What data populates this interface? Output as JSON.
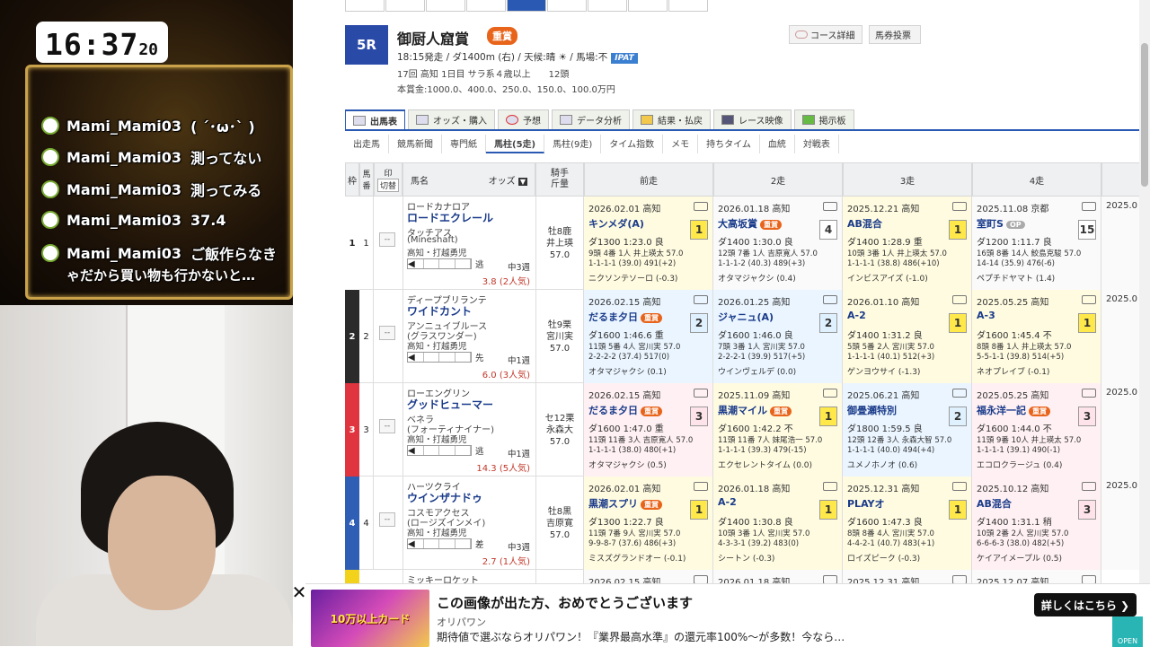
{
  "stream": {
    "clock_hm": "16:37",
    "clock_sec": "20",
    "chat": [
      {
        "user": "Mami_Mami03",
        "msg": "( ´･ω･` )"
      },
      {
        "user": "Mami_Mami03",
        "msg": "測ってない"
      },
      {
        "user": "Mami_Mami03",
        "msg": "測ってみる"
      },
      {
        "user": "Mami_Mami03",
        "msg": "37.4"
      },
      {
        "user": "Mami_Mami03",
        "msg": "ご飯作らなき"
      }
    ],
    "chat_cont": "ゃだから買い物も行かないと…"
  },
  "race": {
    "number": "5R",
    "name": "御厨人窟賞",
    "grade": "重賞",
    "info1": "18:15発走 / ダ1400m (右) / 天候:晴 ☀ / 馬場:不",
    "ipat": "IPAT",
    "info2": "17回 高知 1日目 サラ系４歳以上　　12頭",
    "info3": "本賞金:1000.0、400.0、250.0、150.0、100.0万円",
    "course_btn": "コース詳細",
    "vote_btn": "馬券投票"
  },
  "main_tabs": [
    "出馬表",
    "オッズ・購入",
    "予想",
    "データ分析",
    "結果・払戻",
    "レース映像",
    "掲示板"
  ],
  "sub_tabs": [
    "出走馬",
    "競馬新聞",
    "専門紙",
    "馬柱(5走)",
    "馬柱(9走)",
    "タイム指数",
    "メモ",
    "持ちタイム",
    "血統",
    "対戦表"
  ],
  "headers": {
    "waku": "枠",
    "uma": "馬番",
    "mark": "印",
    "mark_sw": "切替",
    "horse": "馬名",
    "odds": "オッズ",
    "jockey": "騎手\n斤量",
    "p1": "前走",
    "p2": "2走",
    "p3": "3走",
    "p4": "4走"
  },
  "rows": [
    {
      "waku": "1",
      "uma": "1",
      "waku_color": "#ffffff",
      "waku_text": "#222",
      "sire": "ロードカナロア",
      "name": "ロードエクレール",
      "dam": "タッチアス",
      "bms": "(Mineshaft)",
      "owner": "高知・打越勇児",
      "style": "逃",
      "interval": "中3週",
      "odds": "3.8 (2人気)",
      "jockey": [
        "牡8鹿",
        "井上瑛",
        "57.0"
      ],
      "past": [
        {
          "date": "2026.02.01 高知",
          "race": "キンメダ(A)",
          "grade": "",
          "place": "1",
          "l1": "ダ1300 1:23.0 良",
          "l2": "9頭 4番 1人 井上瑛太 57.0",
          "l3": "1-1-1-1 (39.0) 491(+2)",
          "l4": "ニクソンテソーロ (-0.3)",
          "bg": "bg1"
        },
        {
          "date": "2026.01.18 高知",
          "race": "大高坂賞",
          "grade": "重賞",
          "place": "4",
          "l1": "ダ1400 1:30.0 良",
          "l2": "12頭 7番 1人 吉原寛人 57.0",
          "l3": "1-1-1-2 (40.3) 489(+3)",
          "l4": "オタマジャクシ (0.4)",
          "bg": "bgn"
        },
        {
          "date": "2025.12.21 高知",
          "race": "AB混合",
          "grade": "",
          "place": "1",
          "l1": "ダ1400 1:28.9 重",
          "l2": "10頭 3番 1人 井上瑛太 57.0",
          "l3": "1-1-1-1 (38.8) 486(+10)",
          "l4": "インビスアイズ (-1.0)",
          "bg": "bg1"
        },
        {
          "date": "2025.11.08 京都",
          "race": "室町S",
          "grade": "OP",
          "place": "15",
          "l1": "ダ1200 1:11.7 良",
          "l2": "16頭 8番 14人 鮫島克駿 57.0",
          "l3": "14-14 (35.9) 476(-6)",
          "l4": "ペプチドヤマト (1.4)",
          "bg": "bgn"
        }
      ]
    },
    {
      "waku": "2",
      "uma": "2",
      "waku_color": "#2b2b2b",
      "waku_text": "#fff",
      "sire": "ディープブリランテ",
      "name": "ワイドカント",
      "dam": "アンニュイブルース",
      "bms": "(グラスワンダー)",
      "owner": "高知・打越勇児",
      "style": "先",
      "interval": "中1週",
      "odds": "6.0 (3人気)",
      "jockey": [
        "牡9栗",
        "宮川実",
        "57.0"
      ],
      "past": [
        {
          "date": "2026.02.15 高知",
          "race": "だるま夕日",
          "grade": "重賞",
          "place": "2",
          "l1": "ダ1600 1:46.6 重",
          "l2": "11頭 5番 4人 宮川実 57.0",
          "l3": "2-2-2-2 (37.4) 517(0)",
          "l4": "オタマジャクシ (0.1)",
          "bg": "bg2"
        },
        {
          "date": "2026.01.25 高知",
          "race": "ジャニュ(A)",
          "grade": "",
          "place": "2",
          "l1": "ダ1600 1:46.0 良",
          "l2": "7頭 3番 1人 宮川実 57.0",
          "l3": "2-2-2-1 (39.9) 517(+5)",
          "l4": "ウインヴェルデ (0.0)",
          "bg": "bg2"
        },
        {
          "date": "2026.01.10 高知",
          "race": "A-2",
          "grade": "",
          "place": "1",
          "l1": "ダ1400 1:31.2 良",
          "l2": "5頭 5番 2人 宮川実 57.0",
          "l3": "1-1-1-1 (40.1) 512(+3)",
          "l4": "ゲンヨウサイ (-1.3)",
          "bg": "bg1"
        },
        {
          "date": "2025.05.25 高知",
          "race": "A-3",
          "grade": "",
          "place": "1",
          "l1": "ダ1600 1:45.4 不",
          "l2": "8頭 8番 1人 井上瑛太 57.0",
          "l3": "5-5-1-1 (39.8) 514(+5)",
          "l4": "ネオプレイブ (-0.1)",
          "bg": "bg1"
        }
      ]
    },
    {
      "waku": "3",
      "uma": "3",
      "waku_color": "#e0343e",
      "waku_text": "#fff",
      "sire": "ローエングリン",
      "name": "グッドヒューマー",
      "dam": "ベネラ",
      "bms": "(フォーティナイナー)",
      "owner": "高知・打越勇児",
      "style": "逃",
      "interval": "中1週",
      "odds": "14.3 (5人気)",
      "jockey": [
        "セ12栗",
        "永森大",
        "57.0"
      ],
      "past": [
        {
          "date": "2026.02.15 高知",
          "race": "だるま夕日",
          "grade": "重賞",
          "place": "3",
          "l1": "ダ1600 1:47.0 重",
          "l2": "11頭 11番 3人 吉原寛人 57.0",
          "l3": "1-1-1-1 (38.0) 480(+1)",
          "l4": "オタマジャクシ (0.5)",
          "bg": "bg3"
        },
        {
          "date": "2025.11.09 高知",
          "race": "黒潮マイル",
          "grade": "重賞",
          "place": "1",
          "l1": "ダ1600 1:42.2 不",
          "l2": "11頭 11番 7人 妹尾浩一 57.0",
          "l3": "1-1-1-1 (39.3) 479(-15)",
          "l4": "エクセレントタイム (0.0)",
          "bg": "bg1"
        },
        {
          "date": "2025.06.21 高知",
          "race": "御畳瀬特別",
          "grade": "",
          "place": "2",
          "l1": "ダ1800 1:59.5 良",
          "l2": "12頭 12番 3人 永森大智 57.0",
          "l3": "1-1-1-1 (40.0) 494(+4)",
          "l4": "ユメノホノオ (0.6)",
          "bg": "bg2"
        },
        {
          "date": "2025.05.25 高知",
          "race": "福永洋一記",
          "grade": "重賞",
          "place": "3",
          "l1": "ダ1600 1:44.0 不",
          "l2": "11頭 9番 10人 井上瑛太 57.0",
          "l3": "1-1-1-1 (39.1) 490(-1)",
          "l4": "エコロクラージュ (0.4)",
          "bg": "bg3"
        }
      ]
    },
    {
      "waku": "4",
      "uma": "4",
      "waku_color": "#2f5fb5",
      "waku_text": "#fff",
      "sire": "ハーツクライ",
      "name": "ウインザナドゥ",
      "dam": "コスモアクセス",
      "bms": "(ロージズインメイ)",
      "owner": "高知・打越勇児",
      "style": "差",
      "interval": "中3週",
      "odds": "2.7 (1人気)",
      "jockey": [
        "牡8黒",
        "吉原寛",
        "57.0"
      ],
      "past": [
        {
          "date": "2026.02.01 高知",
          "race": "黒潮スプリ",
          "grade": "重賞",
          "place": "1",
          "l1": "ダ1300 1:22.7 良",
          "l2": "11頭 7番 9人 宮川実 57.0",
          "l3": "9-9-8-7 (37.6) 486(+3)",
          "l4": "ミスズグランドオー (-0.1)",
          "bg": "bg1"
        },
        {
          "date": "2026.01.18 高知",
          "race": "A-2",
          "grade": "",
          "place": "1",
          "l1": "ダ1400 1:30.8 良",
          "l2": "10頭 3番 1人 宮川実 57.0",
          "l3": "4-3-3-1 (39.2) 483(0)",
          "l4": "シートン (-0.3)",
          "bg": "bg1"
        },
        {
          "date": "2025.12.31 高知",
          "race": "PLAYオ",
          "grade": "",
          "place": "1",
          "l1": "ダ1600 1:47.3 良",
          "l2": "8頭 8番 4人 宮川実 57.0",
          "l3": "4-4-2-1 (40.7) 483(+1)",
          "l4": "ロイズピーク (-0.3)",
          "bg": "bg1"
        },
        {
          "date": "2025.10.12 高知",
          "race": "AB混合",
          "grade": "",
          "place": "3",
          "l1": "ダ1400 1:31.1 稍",
          "l2": "10頭 2番 2人 宮川実 57.0",
          "l3": "6-6-6-3 (38.0) 482(+5)",
          "l4": "ケイアイメープル (0.5)",
          "bg": "bg3"
        }
      ]
    }
  ],
  "row5_peek": {
    "sire": "ミッキーロケット",
    "dates": [
      "2026.02.15 高知",
      "2026.01.18 高知",
      "2025.12.31 高知",
      "2025.12.07 高知"
    ]
  },
  "col5_peek": [
    "2025.0",
    "2025.0",
    "2025.0",
    "2025.0"
  ],
  "ad": {
    "title": "この画像が出た方、おめでとうございます",
    "source": "オリパワン",
    "desc": "期待値で選ぶならオリパワン！『業界最高水準』の還元率100%〜が多数！今なら…",
    "button": "詳しくはこちら ❯",
    "img_text": "10万以上カード",
    "close": "✕",
    "open": "OPEN"
  }
}
